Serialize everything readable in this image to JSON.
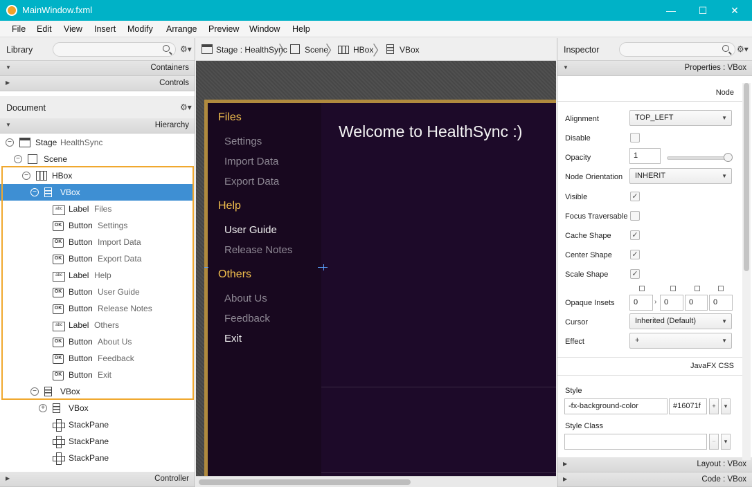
{
  "window": {
    "title": "MainWindow.fxml",
    "minimize": "—",
    "maximize": "☐",
    "close": "✕"
  },
  "menu": [
    "File",
    "Edit",
    "View",
    "Insert",
    "Modify",
    "Arrange",
    "Preview",
    "Window",
    "Help"
  ],
  "library": {
    "title": "Library",
    "sections": [
      "Containers",
      "Controls"
    ]
  },
  "document": {
    "title": "Document",
    "section": "Hierarchy",
    "controller": "Controller",
    "tree": [
      {
        "indent": 0,
        "tog": "−",
        "icon": "stage",
        "type": "Stage",
        "name": "HealthSync"
      },
      {
        "indent": 1,
        "tog": "−",
        "icon": "scene",
        "type": "Scene",
        "name": ""
      },
      {
        "indent": 2,
        "tog": "−",
        "icon": "hbox",
        "type": "HBox",
        "name": ""
      },
      {
        "indent": 3,
        "tog": "−",
        "icon": "vbox",
        "type": "VBox",
        "name": "",
        "selected": true
      },
      {
        "indent": 4,
        "tog": "",
        "icon": "label",
        "type": "Label",
        "name": "Files"
      },
      {
        "indent": 4,
        "tog": "",
        "icon": "button",
        "type": "Button",
        "name": "Settings"
      },
      {
        "indent": 4,
        "tog": "",
        "icon": "button",
        "type": "Button",
        "name": "Import Data"
      },
      {
        "indent": 4,
        "tog": "",
        "icon": "button",
        "type": "Button",
        "name": "Export Data"
      },
      {
        "indent": 4,
        "tog": "",
        "icon": "label",
        "type": "Label",
        "name": "Help"
      },
      {
        "indent": 4,
        "tog": "",
        "icon": "button",
        "type": "Button",
        "name": "User Guide"
      },
      {
        "indent": 4,
        "tog": "",
        "icon": "button",
        "type": "Button",
        "name": "Release Notes"
      },
      {
        "indent": 4,
        "tog": "",
        "icon": "label",
        "type": "Label",
        "name": "Others"
      },
      {
        "indent": 4,
        "tog": "",
        "icon": "button",
        "type": "Button",
        "name": "About Us"
      },
      {
        "indent": 4,
        "tog": "",
        "icon": "button",
        "type": "Button",
        "name": "Feedback"
      },
      {
        "indent": 4,
        "tog": "",
        "icon": "button",
        "type": "Button",
        "name": "Exit"
      },
      {
        "indent": 3,
        "tog": "−",
        "icon": "vbox",
        "type": "VBox",
        "name": ""
      },
      {
        "indent": 4,
        "tog": "+",
        "icon": "vbox",
        "type": "VBox",
        "name": ""
      },
      {
        "indent": 4,
        "tog": "",
        "icon": "stack",
        "type": "StackPane",
        "name": ""
      },
      {
        "indent": 4,
        "tog": "",
        "icon": "stack",
        "type": "StackPane",
        "name": ""
      },
      {
        "indent": 4,
        "tog": "",
        "icon": "stack",
        "type": "StackPane",
        "name": ""
      }
    ]
  },
  "breadcrumb": [
    "Stage : HealthSync",
    "Scene",
    "HBox",
    "VBox"
  ],
  "preview": {
    "welcome": "Welcome to HealthSync :)",
    "items": [
      {
        "kind": "head",
        "text": "Files"
      },
      {
        "kind": "btn",
        "text": "Settings"
      },
      {
        "kind": "btn",
        "text": "Import Data"
      },
      {
        "kind": "btn",
        "text": "Export Data"
      },
      {
        "kind": "head",
        "text": "Help"
      },
      {
        "kind": "btn",
        "text": "User Guide",
        "hi": true
      },
      {
        "kind": "btn",
        "text": "Release Notes"
      },
      {
        "kind": "head",
        "text": "Others"
      },
      {
        "kind": "btn",
        "text": "About Us"
      },
      {
        "kind": "btn",
        "text": "Feedback"
      },
      {
        "kind": "btn",
        "text": "Exit",
        "hi": true
      }
    ]
  },
  "inspector": {
    "title": "Inspector",
    "properties_section": "Properties : VBox",
    "node_heading": "Node",
    "alignment_label": "Alignment",
    "alignment_value": "TOP_LEFT",
    "disable_label": "Disable",
    "opacity_label": "Opacity",
    "opacity_value": "1",
    "opacity_level": 1.0,
    "node_orientation_label": "Node Orientation",
    "node_orientation_value": "INHERIT",
    "visible_label": "Visible",
    "focus_label": "Focus Traversable",
    "cache_label": "Cache Shape",
    "center_label": "Center Shape",
    "scale_label": "Scale Shape",
    "check": "✓",
    "opaque_label": "Opaque Insets",
    "insets": [
      "0",
      "0",
      "0",
      "0"
    ],
    "cursor_label": "Cursor",
    "cursor_value": "Inherited (Default)",
    "effect_label": "Effect",
    "effect_value": "+",
    "css_heading": "JavaFX CSS",
    "style_label": "Style",
    "style_prop": "-fx-background-color",
    "style_value": "#16071f",
    "style_class_label": "Style Class",
    "layout_section": "Layout : VBox",
    "code_section": "Code : VBox"
  },
  "colors": {
    "accent": "#00b2c7",
    "selection": "#3e8fd3",
    "app_bg": "#16071f",
    "heading": "#f3c04d"
  }
}
